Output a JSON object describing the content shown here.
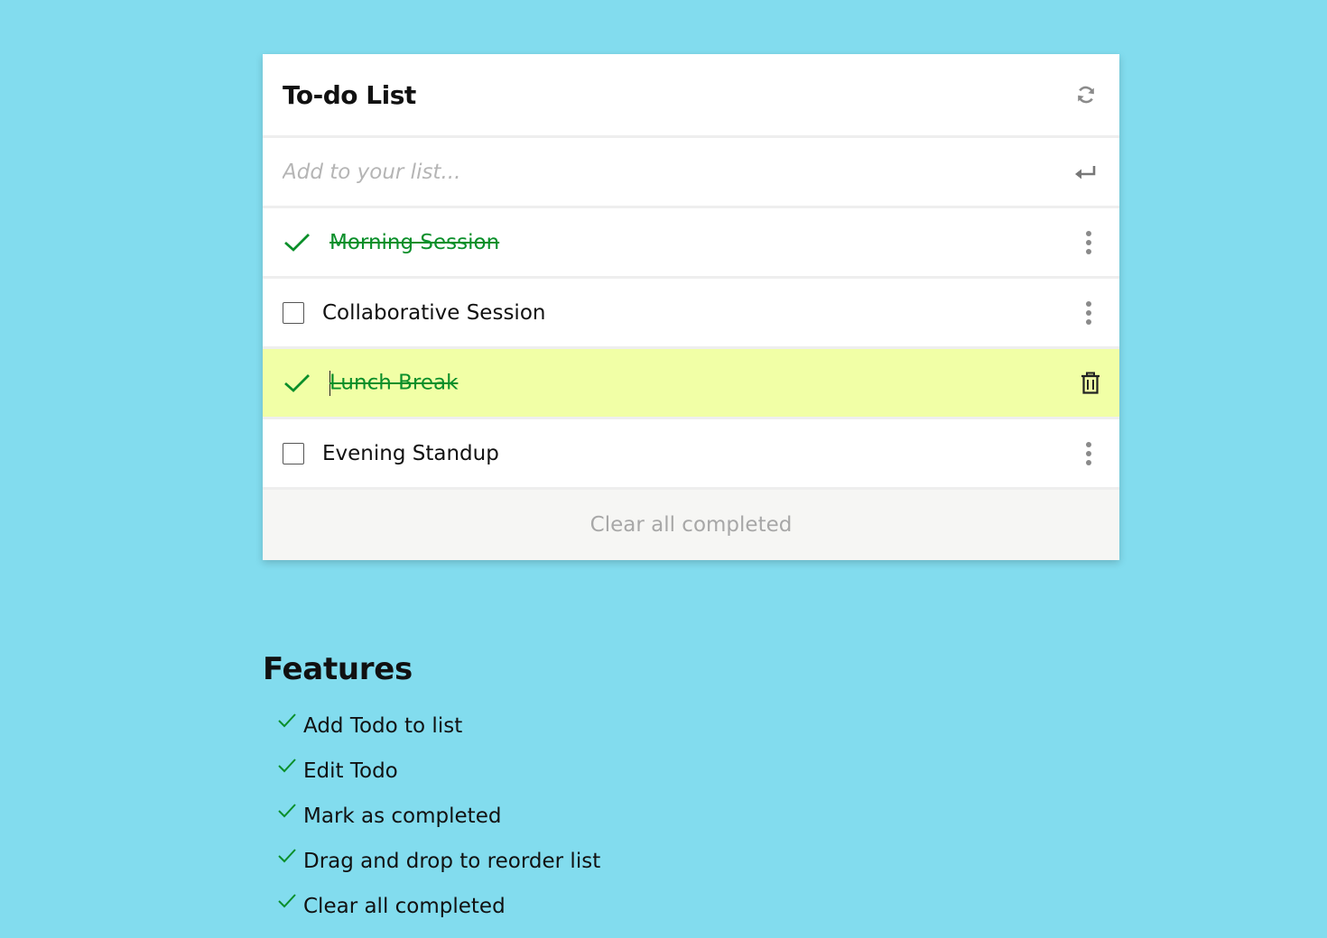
{
  "app": {
    "title": "To-do List"
  },
  "header": {
    "refresh_icon": "refresh-icon"
  },
  "add": {
    "placeholder": "Add to your list...",
    "value": "",
    "enter_icon": "enter-icon"
  },
  "todos": [
    {
      "text": "Morning Session",
      "completed": true,
      "action_icon": "kebab-menu-icon",
      "highlighted": false
    },
    {
      "text": "Collaborative Session",
      "completed": false,
      "action_icon": "kebab-menu-icon",
      "highlighted": false
    },
    {
      "text": "Lunch Break",
      "completed": true,
      "action_icon": "trash-icon",
      "highlighted": true
    },
    {
      "text": "Evening Standup",
      "completed": false,
      "action_icon": "kebab-menu-icon",
      "highlighted": false
    }
  ],
  "footer": {
    "clear_label": "Clear all completed"
  },
  "features": {
    "title": "Features",
    "items": [
      "Add Todo to list",
      "Edit Todo",
      "Mark as completed",
      "Drag and drop to reorder list",
      "Clear all completed"
    ]
  },
  "colors": {
    "background": "#82dcee",
    "completed_text": "#0a8f2a",
    "highlight_row": "#f1ffa6",
    "muted": "#a7a7a7"
  }
}
